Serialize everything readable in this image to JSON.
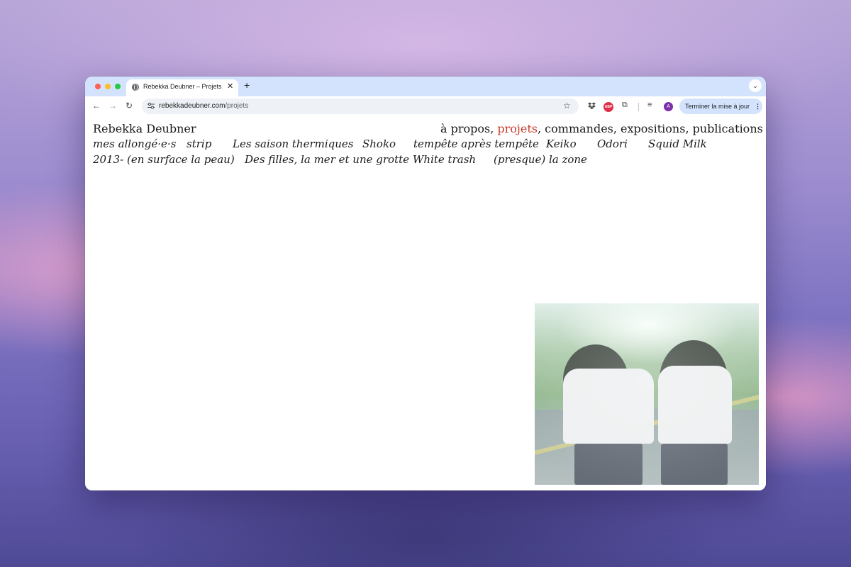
{
  "browser": {
    "tab": {
      "title": "Rebekka Deubner – Projets",
      "close": "✕"
    },
    "new_tab": "+",
    "tab_menu": "⌄",
    "nav": {
      "back": "←",
      "forward": "→",
      "reload": "↻"
    },
    "address": {
      "domain": "rebekkadeubner.com",
      "path": "/projets"
    },
    "bookmark": "☆",
    "extensions": {
      "abp_label": "ABP",
      "puzzle": "⧉",
      "media": "≡"
    },
    "profile_initial": "A",
    "update_button": {
      "label": "Terminer la mise à jour",
      "menu": "⋮"
    }
  },
  "site": {
    "title": "Rebekka Deubner",
    "nav": {
      "about": "à propos",
      "projects": "projets",
      "commissions": "commandes",
      "exhibitions": "expositions",
      "publications": "publications",
      "separator": ", "
    },
    "projects_row1": [
      "mes allongé·e·s",
      "strip",
      "Les saison thermiques",
      "Shoko",
      "tempête après tempête",
      "Keiko",
      "Odori",
      "Squid Milk"
    ],
    "projects_row2": [
      "2013- (en surface la peau)",
      "Des filles, la mer et une grotte",
      "White trash",
      "(presque) la zone"
    ]
  },
  "colors": {
    "active_nav": "#c83c2c",
    "tabbar": "#d3e3fd",
    "update_button": "#d3e3fd"
  }
}
